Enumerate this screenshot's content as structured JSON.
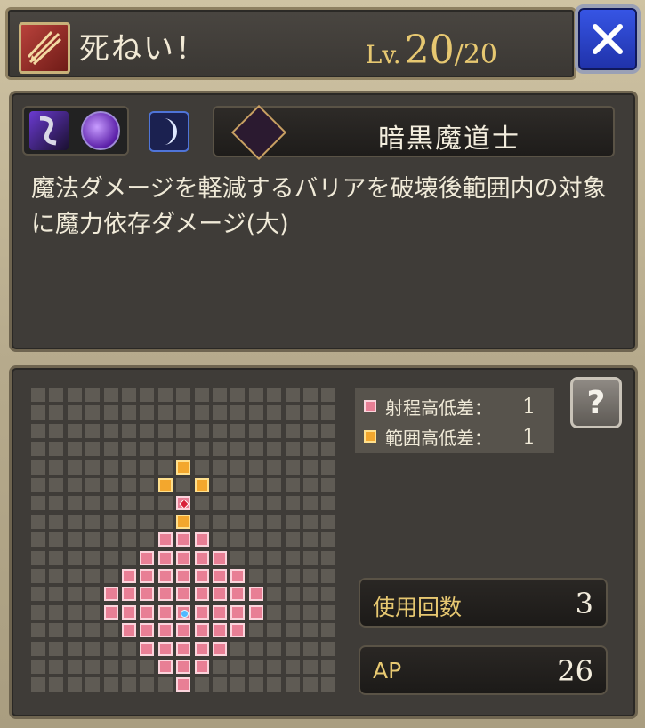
{
  "header": {
    "skill_name": "死ねい！",
    "level_label": "Lv.",
    "level_current": "20",
    "level_max": "/20",
    "skill_icon": "claw-slash-icon",
    "close_icon": "close-x-icon"
  },
  "skill_info": {
    "element_icons": [
      "dark-element-icon",
      "dark-orb-icon"
    ],
    "moon_icon": "crescent-moon-icon",
    "job_icon": "dark-mage-emblem-icon",
    "job_name": "暗黒魔道士",
    "description": "魔法ダメージを軽減するバリアを破壊後範囲内の対象に魔力依存ダメージ(大)"
  },
  "range_map": {
    "grid_size": 17,
    "colors": {
      "range": "#e87f95",
      "area": "#f3a72d",
      "empty": "#5f5b54"
    },
    "legend": [
      {
        "label": "射程高低差：",
        "value": "1",
        "color": "#e87f95"
      },
      {
        "label": "範囲高低差：",
        "value": "1",
        "color": "#f3a72d"
      }
    ],
    "help_label": "?",
    "range_cells": [
      [
        7,
        8
      ],
      [
        8,
        8
      ],
      [
        9,
        8
      ],
      [
        6,
        9
      ],
      [
        7,
        9
      ],
      [
        8,
        9
      ],
      [
        9,
        9
      ],
      [
        10,
        9
      ],
      [
        5,
        10
      ],
      [
        6,
        10
      ],
      [
        7,
        10
      ],
      [
        8,
        10
      ],
      [
        9,
        10
      ],
      [
        10,
        10
      ],
      [
        11,
        10
      ],
      [
        4,
        11
      ],
      [
        5,
        11
      ],
      [
        6,
        11
      ],
      [
        7,
        11
      ],
      [
        8,
        11
      ],
      [
        9,
        11
      ],
      [
        10,
        11
      ],
      [
        11,
        11
      ],
      [
        12,
        11
      ],
      [
        4,
        12
      ],
      [
        5,
        12
      ],
      [
        6,
        12
      ],
      [
        7,
        12
      ],
      [
        8,
        12
      ],
      [
        9,
        12
      ],
      [
        10,
        12
      ],
      [
        11,
        12
      ],
      [
        12,
        12
      ],
      [
        5,
        13
      ],
      [
        6,
        13
      ],
      [
        7,
        13
      ],
      [
        8,
        13
      ],
      [
        9,
        13
      ],
      [
        10,
        13
      ],
      [
        11,
        13
      ],
      [
        6,
        14
      ],
      [
        7,
        14
      ],
      [
        8,
        14
      ],
      [
        9,
        14
      ],
      [
        10,
        14
      ],
      [
        7,
        15
      ],
      [
        8,
        15
      ],
      [
        9,
        15
      ],
      [
        8,
        16
      ],
      [
        8,
        6
      ],
      [
        8,
        7
      ]
    ],
    "area_cells": [
      [
        8,
        4
      ],
      [
        7,
        5
      ],
      [
        9,
        5
      ],
      [
        8,
        7
      ]
    ],
    "target_cell": [
      8,
      6
    ],
    "caster_cell": [
      8,
      12
    ]
  },
  "stats": {
    "uses_label": "使用回数",
    "uses_value": "3",
    "ap_label": "AP",
    "ap_value": "26"
  }
}
